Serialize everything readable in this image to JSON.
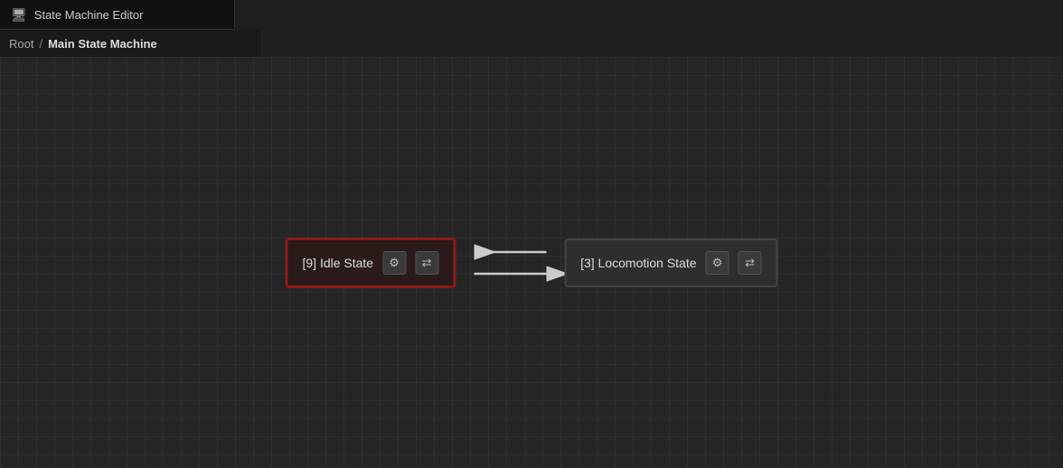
{
  "titleBar": {
    "icon": "🖥",
    "title": "State Machine Editor"
  },
  "breadcrumb": {
    "root": "Root",
    "separator": "/",
    "current": "Main State Machine"
  },
  "nodes": [
    {
      "id": "idle-state",
      "label": "[9] Idle State",
      "active": true,
      "gearLabel": "⚙",
      "swapLabel": "⇄"
    },
    {
      "id": "locomotion-state",
      "label": "[3] Locomotion State",
      "active": false,
      "gearLabel": "⚙",
      "swapLabel": "⇄"
    }
  ],
  "arrows": {
    "fromIdleToLocomotion": "→",
    "fromLocomotionToIdle": "←"
  }
}
